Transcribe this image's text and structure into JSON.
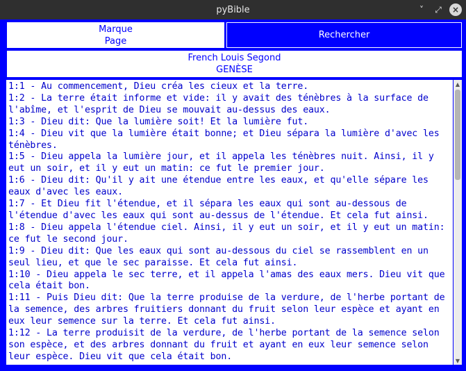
{
  "window": {
    "title": "pyBible",
    "controls": {
      "minimize": "˅",
      "maximize": "⤢",
      "close": "×"
    }
  },
  "toolbar": {
    "marque_label_line1": "Marque",
    "marque_label_line2": "Page",
    "search_label": "Rechercher"
  },
  "header": {
    "translation": "French Louis Segond",
    "book": "GENÈSE"
  },
  "text_lines": [
    "1:1 - Au commencement, Dieu créa les cieux et la terre.",
    "1:2 - La terre était informe et vide: il y avait des ténèbres à la surface de",
    "l'abîme, et l'esprit de Dieu se mouvait au-dessus des eaux.",
    "1:3 - Dieu dit: Que la lumière soit! Et la lumière fut.",
    "1:4 - Dieu vit que la lumière était bonne; et Dieu sépara la lumière d'avec les",
    "ténèbres.",
    "1:5 - Dieu appela la lumière jour, et il appela les ténèbres nuit. Ainsi, il y",
    "eut un soir, et il y eut un matin: ce fut le premier jour.",
    "1:6 - Dieu dit: Qu'il y ait une étendue entre les eaux, et qu'elle sépare les",
    "eaux d'avec les eaux.",
    "1:7 - Et Dieu fit l'étendue, et il sépara les eaux qui sont au-dessous de",
    "l'étendue d'avec les eaux qui sont au-dessus de l'étendue. Et cela fut ainsi.",
    "1:8 - Dieu appela l'étendue ciel. Ainsi, il y eut un soir, et il y eut un matin:",
    "ce fut le second jour.",
    "1:9 - Dieu dit: Que les eaux qui sont au-dessous du ciel se rassemblent en un",
    "seul lieu, et que le sec paraisse. Et cela fut ainsi.",
    "1:10 - Dieu appela le sec terre, et il appela l'amas des eaux mers. Dieu vit que",
    "cela était bon.",
    "1:11 - Puis Dieu dit: Que la terre produise de la verdure, de l'herbe portant de",
    "la semence, des arbres fruitiers donnant du fruit selon leur espèce et ayant en",
    "eux leur semence sur la terre. Et cela fut ainsi.",
    "1:12 - La terre produisit de la verdure, de l'herbe portant de la semence selon",
    "son espèce, et des arbres donnant du fruit et ayant en eux leur semence selon",
    "leur espèce. Dieu vit que cela était bon."
  ],
  "colors": {
    "accent": "#0000ff",
    "text": "#0000cc",
    "titlebar": "#2f2f2f"
  },
  "icons": {
    "scroll_up": "scroll-up-arrow-icon",
    "scroll_down": "scroll-down-arrow-icon"
  }
}
